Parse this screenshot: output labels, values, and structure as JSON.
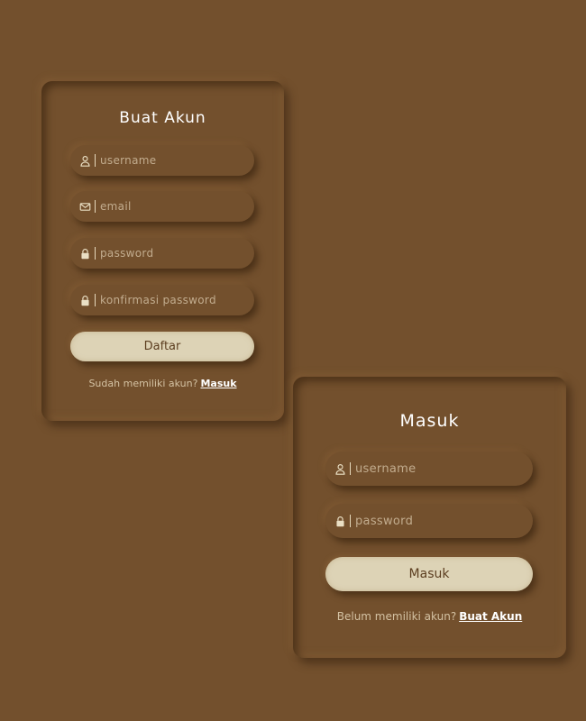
{
  "register_card": {
    "title": "Buat Akun",
    "fields": [
      {
        "icon": "user-icon",
        "placeholder": "username"
      },
      {
        "icon": "mail-icon",
        "placeholder": "email"
      },
      {
        "icon": "lock-icon",
        "placeholder": "password"
      },
      {
        "icon": "lock-icon",
        "placeholder": "konfirmasi password"
      }
    ],
    "submit_label": "Daftar",
    "footer_text": "Sudah memiliki akun?",
    "footer_link": "Masuk"
  },
  "login_card": {
    "title": "Masuk",
    "fields": [
      {
        "icon": "user-icon",
        "placeholder": "username"
      },
      {
        "icon": "lock-icon",
        "placeholder": "password"
      }
    ],
    "submit_label": "Masuk",
    "footer_text": "Belum memiliki akun?",
    "footer_link": "Buat Akun"
  },
  "colors": {
    "background": "#73502d",
    "button": "#ddd3b6",
    "button_text": "#5c3e20",
    "title_text": "#ffffff",
    "muted_text": "#d4c2a3"
  }
}
